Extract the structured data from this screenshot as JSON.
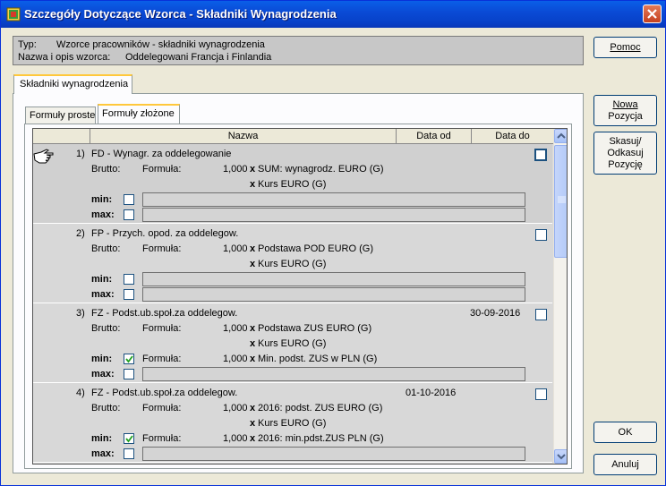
{
  "window": {
    "title": "Szczegóły Dotyczące Wzorca - Składniki Wynagrodzenia"
  },
  "info": {
    "type_label": "Typ:",
    "type_value": "Wzorce pracowników - składniki wynagrodzenia",
    "name_label": "Nazwa i opis wzorca:",
    "name_value": "Oddelegowani Francja i Finlandia"
  },
  "buttons": {
    "help": "Pomoc",
    "new_line1": "Nowa",
    "new_line2": "Pozycja",
    "del_line1": "Skasuj/",
    "del_line2": "Odkasuj",
    "del_line3": "Pozycję",
    "ok": "OK",
    "cancel": "Anuluj"
  },
  "tabs": {
    "outer": "Składniki wynagrodzenia",
    "inner_simple": "Formuły proste",
    "inner_complex": "Formuły złożone"
  },
  "columns": {
    "name": "Nazwa",
    "date_from": "Data od",
    "date_to": "Data do"
  },
  "common": {
    "brutto": "Brutto:",
    "formula": "Formuła:",
    "min": "min:",
    "max": "max:",
    "times": "x"
  },
  "records": [
    {
      "index": "1)",
      "title": "FD - Wynagr. za oddelegowanie",
      "date_from": "",
      "date_to": "",
      "coef": "1,000",
      "comp1": "SUM: wynagrodz. EURO (G)",
      "comp2": "Kurs EURO (G)",
      "min_checked": false,
      "min_coef": "",
      "min_comp": ""
    },
    {
      "index": "2)",
      "title": "FP - Przych. opod. za oddelegow.",
      "date_from": "",
      "date_to": "",
      "coef": "1,000",
      "comp1": "Podstawa POD EURO (G)",
      "comp2": "Kurs EURO (G)",
      "min_checked": false,
      "min_coef": "",
      "min_comp": ""
    },
    {
      "index": "3)",
      "title": "FZ - Podst.ub.społ.za oddelegow.",
      "date_from": "",
      "date_to": "30-09-2016",
      "coef": "1,000",
      "comp1": "Podstawa ZUS EURO (G)",
      "comp2": "Kurs EURO (G)",
      "min_checked": true,
      "min_coef": "1,000",
      "min_comp": "Min. podst. ZUS w PLN (G)"
    },
    {
      "index": "4)",
      "title": "FZ - Podst.ub.społ.za oddelegow.",
      "date_from": "01-10-2016",
      "date_to": "",
      "coef": "1,000",
      "comp1": "2016: podst. ZUS EURO (G)",
      "comp2": "Kurs EURO (G)",
      "min_checked": true,
      "min_coef": "1,000",
      "min_comp": "2016: min.pdst.ZUS PLN (G)"
    }
  ],
  "colors": {
    "titlebar": "#0a4bd6",
    "dialog": "#ece9d8",
    "grid": "#d8d8d8"
  }
}
